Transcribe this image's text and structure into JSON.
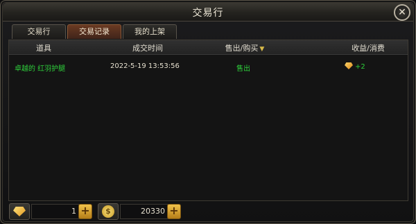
{
  "window": {
    "title": "交易行"
  },
  "tabs": [
    {
      "label": "交易行",
      "active": false
    },
    {
      "label": "交易记录",
      "active": true
    },
    {
      "label": "我的上架",
      "active": false
    }
  ],
  "table": {
    "headers": [
      "道具",
      "成交时间",
      "售出/购买",
      "收益/消费"
    ],
    "rows": [
      {
        "item": "卓越的 红羽护腿",
        "time": "2022-5-19 13:53:56",
        "type": "售出",
        "amount": "+2",
        "amount_icon": "gem-icon"
      }
    ]
  },
  "footer": {
    "gem": {
      "icon": "gem-icon",
      "value": "1"
    },
    "coin": {
      "icon": "coin-icon",
      "glyph": "$",
      "value": "20330"
    }
  },
  "colors": {
    "accent_green": "#2ecf3b",
    "active_tab": "#6a3a22",
    "gold": "#d7b949"
  }
}
